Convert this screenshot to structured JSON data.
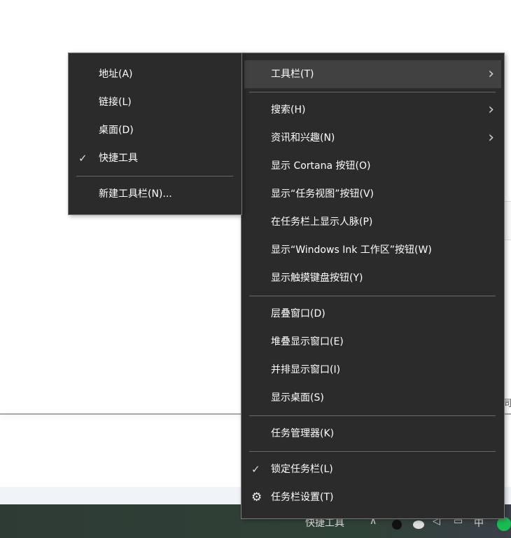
{
  "background": {
    "side_text": "同"
  },
  "taskbar": {
    "quick_tools": "快捷工具",
    "chevron": "∧",
    "ime": "中"
  },
  "main_menu": {
    "groups": [
      [
        {
          "label": "工具栏(T)",
          "submenu": true,
          "highlighted": true
        }
      ],
      [
        {
          "label": "搜索(H)",
          "submenu": true
        },
        {
          "label": "资讯和兴趣(N)",
          "submenu": true
        },
        {
          "label": "显示 Cortana 按钮(O)"
        },
        {
          "label": "显示“任务视图”按钮(V)"
        },
        {
          "label": "在任务栏上显示人脉(P)"
        },
        {
          "label": "显示“Windows Ink 工作区”按钮(W)"
        },
        {
          "label": "显示触摸键盘按钮(Y)"
        }
      ],
      [
        {
          "label": "层叠窗口(D)"
        },
        {
          "label": "堆叠显示窗口(E)"
        },
        {
          "label": "并排显示窗口(I)"
        },
        {
          "label": "显示桌面(S)"
        }
      ],
      [
        {
          "label": "任务管理器(K)"
        }
      ],
      [
        {
          "label": "锁定任务栏(L)",
          "checked": true
        },
        {
          "label": "任务栏设置(T)",
          "icon": "gear-icon"
        }
      ]
    ]
  },
  "toolbar_submenu": {
    "groups": [
      [
        {
          "label": "地址(A)"
        },
        {
          "label": "链接(L)"
        },
        {
          "label": "桌面(D)"
        },
        {
          "label": "快捷工具",
          "checked": true
        }
      ],
      [
        {
          "label": "新建工具栏(N)..."
        }
      ]
    ]
  }
}
